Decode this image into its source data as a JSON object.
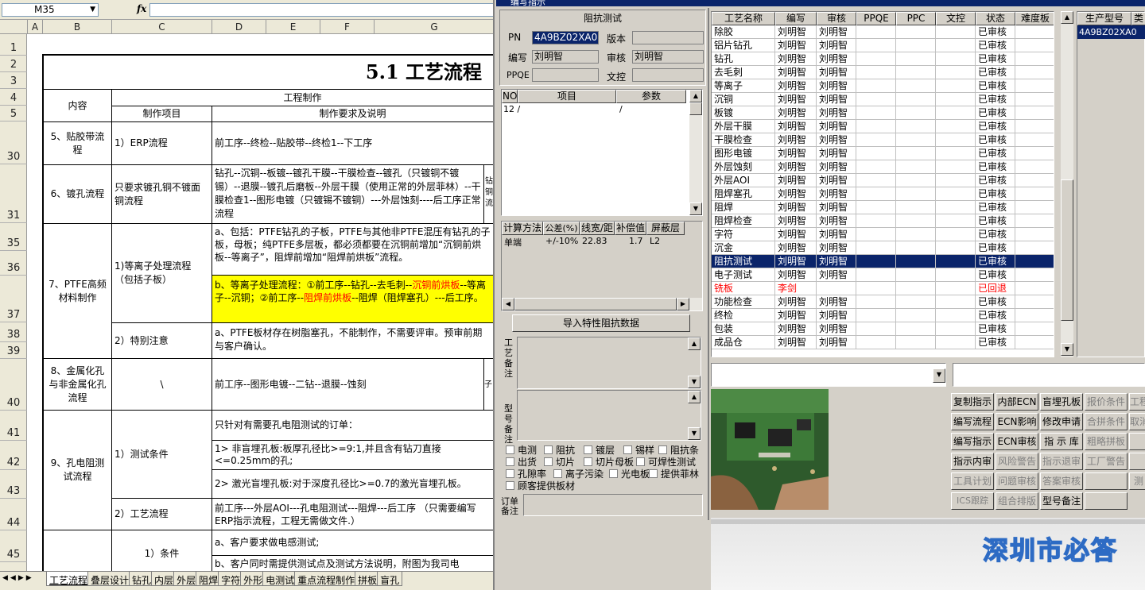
{
  "excel": {
    "name_box": "M35",
    "fx": "fx",
    "columns": [
      "A",
      "B",
      "C",
      "D",
      "E",
      "F",
      "G"
    ],
    "row_numbers": [
      "1",
      "2",
      "3",
      "4",
      "5",
      "30",
      "31",
      "35",
      "36",
      "37",
      "38",
      "39",
      "40",
      "41",
      "42",
      "43",
      "44",
      "45"
    ],
    "title": "5.1 工艺流程",
    "hdr_content": "内容",
    "hdr_engineering": "工程制作",
    "hdr_item": "制作项目",
    "hdr_req": "制作要求及说明",
    "r5_content": "5、贴胶带流程",
    "r5_item": "1）ERP流程",
    "r5_req": "前工序--终检--贴胶带--终检1--下工序",
    "r6_content": "6、镀孔流程",
    "r6_item": "只要求镀孔铜不镀面铜流程",
    "r6_req": "钻孔--沉铜--板镀--镀孔干膜--干膜检查--镀孔（只镀铜不镀锡）--退膜--镀孔后磨板--外层干膜（使用正常的外层菲林）--干膜检查1--图形电镀（只镀锡不镀铜）---外层蚀刻----后工序正常流程",
    "r6_side": "钻铜流",
    "r7_content": "7、PTFE高频材料制作",
    "r7_item1": "1)等离子处理流程（包括子板）",
    "r7_req1": "a、包括：PTFE钻孔的子板，PTFE与其他非PTFE混压有钻孔的子板，母板；纯PTFE多层板，都必须都要在沉铜前增加“沉铜前烘板--等离子”，阻焊前增加“阻焊前烘板”流程。",
    "r7_req2a": "b、等离子处理流程：①前工序--钻孔--去毛刺--",
    "r7_req2b": "沉铜前烘板",
    "r7_req2c": "--等离子--沉铜；②前工序--",
    "r7_req2d": "阻焊前烘板",
    "r7_req2e": "--阻焊（阻焊塞孔）---后工序。",
    "r7_item2": "2）特别注意",
    "r7_req3": "a、PTFE板材存在树脂塞孔，不能制作，不需要评审。预审前期与客户确认。",
    "r8_content": "8、金属化孔与非金属化孔流程",
    "r8_item": "\\",
    "r8_req": "前工序--图形电镀--二钻--退膜--蚀刻",
    "r8_side": "子",
    "r9_content": "9、孔电阻测试流程",
    "r9_item1": "1）测试条件",
    "r9_req1": "只针对有需要孔电阻测试的订单：",
    "r9_req2": "1> 非盲埋孔板:板厚孔径比>=9:1,并且含有钻刀直接<=0.25mm的孔;",
    "r9_req3": "2> 激光盲埋孔板:对于深度孔径比>=0.7的激光盲埋孔板。",
    "r9_item2": "2）工艺流程",
    "r9_req4": "前工序---外层AOI---孔电阻测试---阻焊---后工序 （只需要编写ERP指示流程，工程无需做文件.）",
    "r10_item": "1）条件",
    "r10_req1": "a、客户要求做电感测试;",
    "r10_req2": "b、客户同时需提供测试点及测试方法说明，附图为我司电",
    "sheet_tabs": [
      "工艺流程",
      "叠层设计",
      "钻孔",
      "内层",
      "外层",
      "阻焊",
      "字符",
      "外形",
      "电测试",
      "重点流程制作",
      "拼板",
      "盲孔"
    ]
  },
  "win": {
    "title": "编写指示",
    "section_title": "阻抗测试",
    "pn_label": "PN",
    "pn_value": "4A9BZ02XA0",
    "version_label": "版本",
    "version_value": "",
    "writer_label": "编写",
    "writer_value": "刘明智",
    "reviewer_label": "审核",
    "reviewer_value": "刘明智",
    "ppqe_label": "PPQE",
    "ppqe_value": "",
    "wenkong_label": "文控",
    "wenkong_value": "",
    "param_headers": [
      "NO",
      "项目",
      "参数"
    ],
    "param_row": [
      "12 /",
      "",
      "/"
    ],
    "calc_headers": [
      "计算方法",
      "公差(%)",
      "线宽/距",
      "补偿值",
      "屏蔽层"
    ],
    "calc_row": [
      "单端",
      "+/-10%",
      "22.83",
      "1.7",
      "L2"
    ],
    "import_button": "导入特性阻抗数据",
    "process_note_label": "工艺备注",
    "model_note_label": "型号备注",
    "order_note_label": "订单备注",
    "checkboxes": [
      [
        "电测",
        "阻抗",
        "镀层",
        "锡样",
        "阻抗条"
      ],
      [
        "出货",
        "切片",
        "切片母板",
        "可焊性测试"
      ],
      [
        "孔隙率",
        "离子污染",
        "光电板",
        "提供菲林"
      ],
      [
        "顾客提供板材"
      ]
    ],
    "proc_headers": [
      "工艺名称",
      "编写",
      "审核",
      "PPQE",
      "PPC",
      "文控",
      "状态",
      "难度板"
    ],
    "proc_rows": [
      [
        "除胶",
        "刘明智",
        "刘明智",
        "",
        "",
        "",
        "已审核",
        ""
      ],
      [
        "铝片钻孔",
        "刘明智",
        "刘明智",
        "",
        "",
        "",
        "已审核",
        ""
      ],
      [
        "钻孔",
        "刘明智",
        "刘明智",
        "",
        "",
        "",
        "已审核",
        ""
      ],
      [
        "去毛刺",
        "刘明智",
        "刘明智",
        "",
        "",
        "",
        "已审核",
        ""
      ],
      [
        "等离子",
        "刘明智",
        "刘明智",
        "",
        "",
        "",
        "已审核",
        ""
      ],
      [
        "沉铜",
        "刘明智",
        "刘明智",
        "",
        "",
        "",
        "已审核",
        ""
      ],
      [
        "板镀",
        "刘明智",
        "刘明智",
        "",
        "",
        "",
        "已审核",
        ""
      ],
      [
        "外层干膜",
        "刘明智",
        "刘明智",
        "",
        "",
        "",
        "已审核",
        ""
      ],
      [
        "干膜检查",
        "刘明智",
        "刘明智",
        "",
        "",
        "",
        "已审核",
        ""
      ],
      [
        "图形电镀",
        "刘明智",
        "刘明智",
        "",
        "",
        "",
        "已审核",
        ""
      ],
      [
        "外层蚀刻",
        "刘明智",
        "刘明智",
        "",
        "",
        "",
        "已审核",
        ""
      ],
      [
        "外层AOI",
        "刘明智",
        "刘明智",
        "",
        "",
        "",
        "已审核",
        ""
      ],
      [
        "阻焊塞孔",
        "刘明智",
        "刘明智",
        "",
        "",
        "",
        "已审核",
        ""
      ],
      [
        "阻焊",
        "刘明智",
        "刘明智",
        "",
        "",
        "",
        "已审核",
        ""
      ],
      [
        "阻焊检查",
        "刘明智",
        "刘明智",
        "",
        "",
        "",
        "已审核",
        ""
      ],
      [
        "字符",
        "刘明智",
        "刘明智",
        "",
        "",
        "",
        "已审核",
        ""
      ],
      [
        "沉金",
        "刘明智",
        "刘明智",
        "",
        "",
        "",
        "已审核",
        ""
      ],
      [
        "阻抗测试",
        "刘明智",
        "刘明智",
        "",
        "",
        "",
        "已审核",
        ""
      ],
      [
        "电子测试",
        "刘明智",
        "刘明智",
        "",
        "",
        "",
        "已审核",
        ""
      ],
      [
        "铣板",
        "李剑",
        "",
        "",
        "",
        "",
        "已回退",
        ""
      ],
      [
        "功能检查",
        "刘明智",
        "刘明智",
        "",
        "",
        "",
        "已审核",
        ""
      ],
      [
        "终检",
        "刘明智",
        "刘明智",
        "",
        "",
        "",
        "已审核",
        ""
      ],
      [
        "包装",
        "刘明智",
        "刘明智",
        "",
        "",
        "",
        "已审核",
        ""
      ],
      [
        "成品仓",
        "刘明智",
        "刘明智",
        "",
        "",
        "",
        "已审核",
        ""
      ]
    ],
    "selected_row": 17,
    "rejected_row": 19,
    "model_headers": [
      "生产型号",
      "类"
    ],
    "model_value": "4A9BZ02XA0",
    "buttons": [
      [
        "复制指示",
        "内部ECN",
        "盲埋孔板",
        "报价条件",
        "工程"
      ],
      [
        "编写流程",
        "ECN影响",
        "修改申请",
        "合拼条件",
        "取消"
      ],
      [
        "编写指示",
        "ECN审核",
        "指 示 库",
        "粗略拼板",
        ""
      ],
      [
        "指示内审",
        "风险警告",
        "指示退审",
        "工厂警告",
        ""
      ],
      [
        "工具计划",
        "问题审核",
        "答案审核",
        "",
        "测"
      ],
      [
        "ICS跟踪",
        "组合排版",
        "型号备注",
        "",
        ""
      ]
    ],
    "disabled_buttons": [
      "报价条件",
      "工程",
      "合拼条件",
      "取消",
      "粗略拼板",
      "风险警告",
      "指示退审",
      "工厂警告",
      "工具计划",
      "问题审核",
      "答案审核",
      "测",
      "ICS跟踪",
      "组合排版"
    ],
    "company_text": "深圳市必答"
  }
}
